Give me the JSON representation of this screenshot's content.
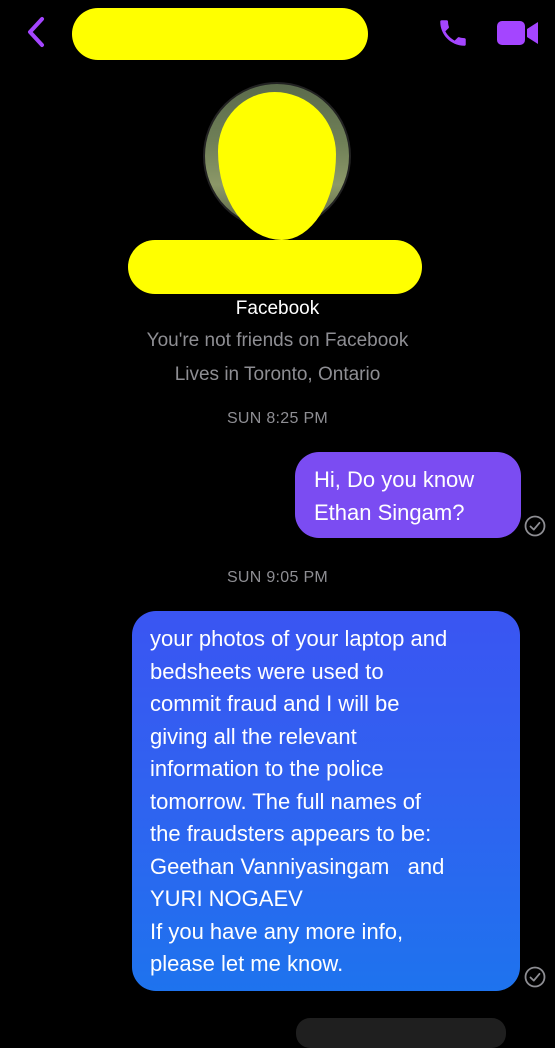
{
  "header": {
    "back_icon": "chevron-left-icon",
    "call_icon": "phone-icon",
    "video_icon": "video-camera-icon",
    "accent_color": "#a445ff"
  },
  "profile": {
    "platform": "Facebook",
    "friend_status": "You're not friends on Facebook",
    "location": "Lives in Toronto, Ontario",
    "redaction_color": "#ffff00"
  },
  "conversation": {
    "timestamp_1": "SUN 8:25 PM",
    "timestamp_2": "SUN 9:05 PM",
    "message_1": {
      "lines": [
        "Hi, Do you know",
        "Ethan Singam?"
      ],
      "color": "#7b4cf2"
    },
    "message_2": {
      "lines": [
        "your photos of your laptop and",
        "bedsheets were used to",
        "commit fraud and I will be",
        "giving all the relevant",
        "information to the police",
        "tomorrow. The full names of",
        "the fraudsters appears to be:",
        "Geethan Vanniyasingam   and",
        "YURI NOGAEV",
        "If you have any more info,",
        "please let me know."
      ],
      "color": "#2f63f0"
    },
    "read_receipt_icon": "check-circle-icon"
  }
}
